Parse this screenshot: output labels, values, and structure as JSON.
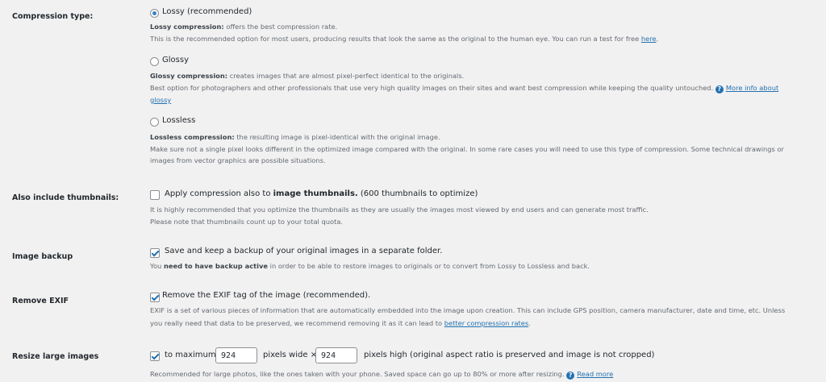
{
  "compression": {
    "label": "Compression type:",
    "lossy": {
      "label": "Lossy (recommended)",
      "desc1_bold": "Lossy compression:",
      "desc1_rest": " offers the best compression rate.",
      "desc2_text": "This is the recommended option for most users, producing results that look the same as the original to the human eye. You can run a test for free ",
      "desc2_link": "here",
      "desc2_end": "."
    },
    "glossy": {
      "label": "Glossy",
      "desc1_bold": "Glossy compression:",
      "desc1_rest": " creates images that are almost pixel-perfect identical to the originals.",
      "desc2_text": "Best option for photographers and other professionals that use very high quality images on their sites and want best compression while keeping the quality untouched.",
      "help_icon": "?",
      "more_link_1": "More info about",
      "more_link_2": "glossy"
    },
    "lossless": {
      "label": "Lossless",
      "desc1_bold": "Lossless compression:",
      "desc1_rest": " the resulting image is pixel-identical with the original image.",
      "desc2": "Make sure not a single pixel looks different in the optimized image compared with the original. In some rare cases you will need to use this type of compression. Some technical drawings or",
      "desc3": "images from vector graphics are possible situations."
    },
    "selected": "lossy"
  },
  "thumbnails": {
    "label": "Also include thumbnails:",
    "option_pre": "Apply compression also to ",
    "option_bold": "image thumbnails.",
    "option_post": " (600 thumbnails to optimize)",
    "checked": false,
    "desc1": "It is highly recommended that you optimize the thumbnails as they are usually the images most viewed by end users and can generate most traffic.",
    "desc2": "Please note that thumbnails count up to your total quota."
  },
  "backup": {
    "label": "Image backup",
    "option": "Save and keep a backup of your original images in a separate folder.",
    "checked": true,
    "desc_pre": "You ",
    "desc_bold": "need to have backup active",
    "desc_post": " in order to be able to restore images to originals or to convert from Lossy to Lossless and back."
  },
  "exif": {
    "label": "Remove EXIF",
    "option": "Remove the EXIF tag of the image (recommended).",
    "checked": true,
    "desc1": "EXIF is a set of various pieces of information that are automatically embedded into the image upon creation. This can include GPS position, camera manufacturer, date and time, etc. Unless",
    "desc2_pre": "you really need that data to be preserved, we recommend removing it as it can lead to ",
    "desc2_link": "better compression rates",
    "desc2_end": "."
  },
  "resize": {
    "label": "Resize large images",
    "checked": true,
    "to_max": "to maximum",
    "width": "924",
    "pixels_wide": "pixels wide ×",
    "height": "924",
    "pixels_high": "pixels high (original aspect ratio is preserved and image is not cropped)",
    "desc": "Recommended for large photos, like the ones taken with your phone. Saved space can go up to 80% or more after resizing.",
    "help_icon": "?",
    "read_more": "Read more"
  }
}
